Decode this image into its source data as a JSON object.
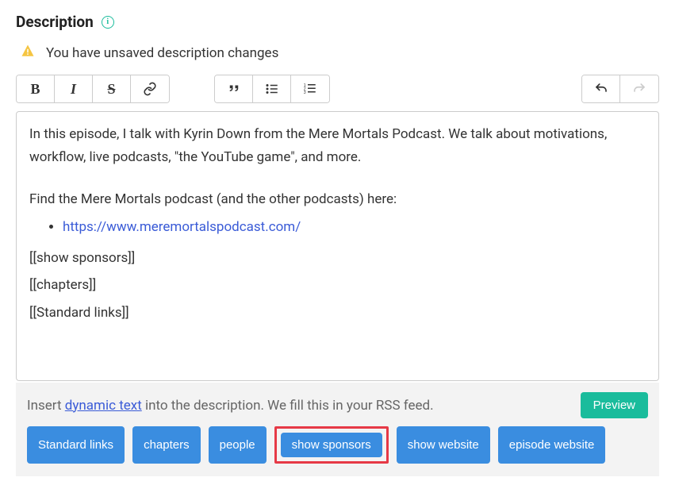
{
  "header": {
    "title": "Description"
  },
  "warning": {
    "text": "You have unsaved description changes"
  },
  "editor": {
    "para1": "In this episode, I talk with Kyrin Down from the Mere Mortals Podcast. We talk about motivations, workflow, live podcasts, \"the YouTube game\", and more.",
    "para2": "Find the Mere Mortals podcast (and the other podcasts) here:",
    "link1": "https://www.meremortalspodcast.com/",
    "sc1": "[[show sponsors]]",
    "sc2": "[[chapters]]",
    "sc3": "[[Standard links]]"
  },
  "footer": {
    "insert_prefix": "Insert ",
    "insert_dynamic": "dynamic text",
    "insert_suffix": " into the description. We fill this in your RSS feed.",
    "preview": "Preview",
    "chips": {
      "standard_links": "Standard links",
      "chapters": "chapters",
      "people": "people",
      "show_sponsors": "show sponsors",
      "show_website": "show website",
      "episode_website": "episode website"
    }
  }
}
